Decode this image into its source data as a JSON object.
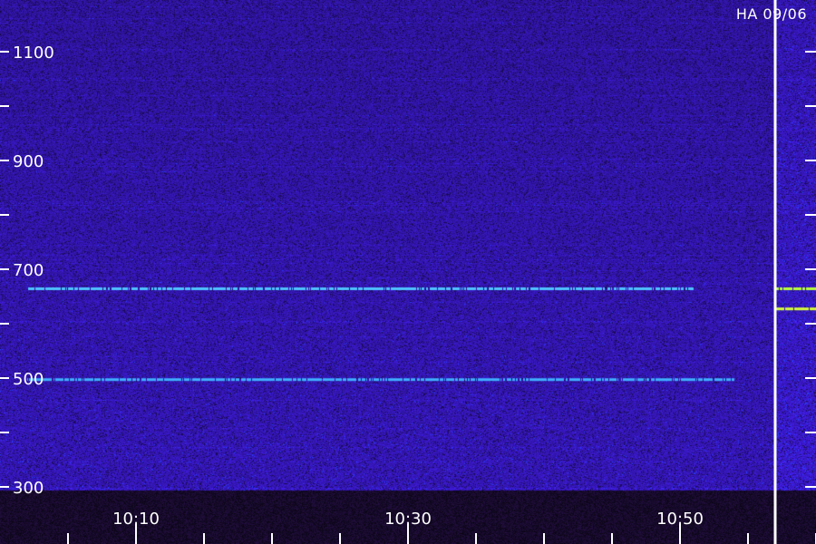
{
  "header": {
    "station": "HA",
    "date": "09/06"
  },
  "chart_data": {
    "type": "heatmap",
    "title": "",
    "xlabel": "",
    "ylabel": "",
    "x_start": "10:02",
    "x_end": "11:00",
    "x_ticks": [
      {
        "time": "10:10",
        "minutes": 610
      },
      {
        "time": "10:30",
        "minutes": 630
      },
      {
        "time": "10:50",
        "minutes": 650
      }
    ],
    "x_minor_ticks_min": [
      605,
      615,
      620,
      625,
      635,
      640,
      645,
      655,
      660
    ],
    "y_ticks": [
      300,
      500,
      700,
      900,
      1100
    ],
    "y_minor_ticks": [
      400,
      600,
      800,
      1000,
      1200
    ],
    "ylim": [
      300,
      1200
    ],
    "lines": [
      {
        "freq": 665,
        "start": "10:02",
        "end": "10:51",
        "color": "#4fc3ff"
      },
      {
        "freq": 498,
        "start": "10:02",
        "end": "10:54",
        "color": "#3fb0ff"
      },
      {
        "freq": 665,
        "start": "10:57",
        "end": "11:00",
        "color": "#b8ff3a"
      },
      {
        "freq": 628,
        "start": "10:57",
        "end": "11:00",
        "color": "#d8ff3a"
      }
    ],
    "marker_time": "10:57",
    "colors": {
      "background": "#2a0f6b",
      "noise_low": "#14063a",
      "noise_high": "#3a22c8",
      "axis_band": "#0a0516",
      "marker": "#ffffff"
    }
  }
}
